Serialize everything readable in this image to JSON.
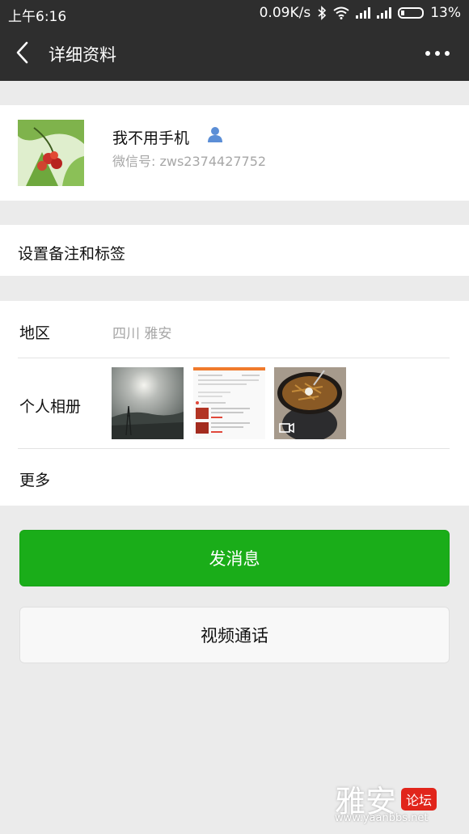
{
  "status_bar": {
    "time": "上午6:16",
    "network_speed": "0.09K/s",
    "battery": "13%"
  },
  "header": {
    "title": "详细资料"
  },
  "profile": {
    "name": "我不用手机",
    "wechat_id": "微信号: zws2374427752"
  },
  "remark": {
    "label": "设置备注和标签"
  },
  "details": {
    "region_label": "地区",
    "region_value": "四川  雅安",
    "album_label": "个人相册",
    "more_label": "更多"
  },
  "actions": {
    "send_message": "发消息",
    "video_call": "视频通话"
  },
  "watermark": {
    "main": "雅安",
    "tag": "论坛",
    "url": "www.yaanbbs.net"
  },
  "colors": {
    "header_bg": "#2e2e2e",
    "primary_green": "#1aad19",
    "page_bg": "#ebebeb"
  }
}
